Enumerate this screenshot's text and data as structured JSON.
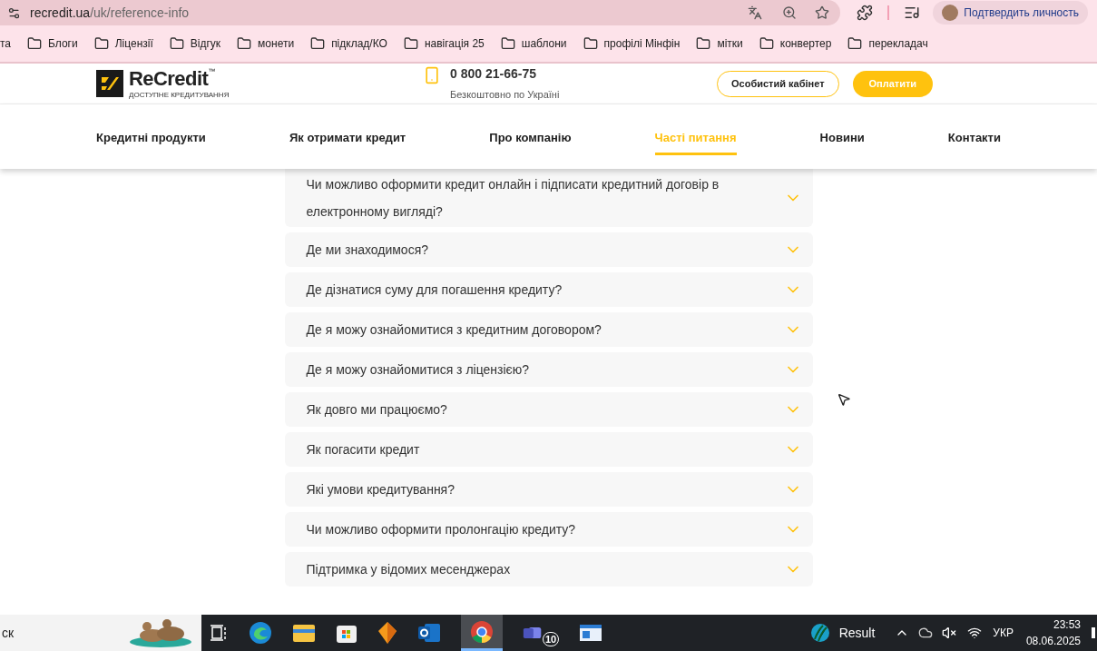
{
  "browser": {
    "url_host": "recredit.ua",
    "url_path": "/uk/reference-info",
    "profile_label": "Подтвердить личность",
    "bookmarks": [
      "та",
      "Блоги",
      "Ліцензії",
      "Відгук",
      "монети",
      "підклад/КО",
      "навігація 25",
      "шаблони",
      "профілі Мінфін",
      "мітки",
      "конвертер",
      "перекладач"
    ]
  },
  "header": {
    "logo_text": "ReCredit",
    "logo_tm": "™",
    "logo_tagline": "ДОСТУПНЕ КРЕДИТУВАННЯ",
    "phone": "0 800 21-66-75",
    "phone_note": "Безкоштовно по Україні",
    "cabinet_button": "Особистий кабінет",
    "pay_button": "Оплатити"
  },
  "nav": [
    {
      "label": "Кредитні продукти",
      "selected": false
    },
    {
      "label": "Як отримати кредит",
      "selected": false
    },
    {
      "label": "Про компанію",
      "selected": false
    },
    {
      "label": "Часті питання",
      "selected": true
    },
    {
      "label": "Новини",
      "selected": false
    },
    {
      "label": "Контакти",
      "selected": false
    }
  ],
  "faq": [
    {
      "question": "Чи можливо оформити кредит онлайн і підписати кредитний договір в електронному вигляді?",
      "expanded": false
    },
    {
      "question": "Де ми знаходимося?",
      "expanded": false
    },
    {
      "question": "Де дізнатися суму для погашення кредиту?",
      "expanded": false
    },
    {
      "question": "Де я можу ознайомитися з кредитним договором?",
      "expanded": false
    },
    {
      "question": "Де я можу ознайомитися з ліцензією?",
      "expanded": false
    },
    {
      "question": "Як довго ми працюємо?",
      "expanded": false
    },
    {
      "question": "Як погасити кредит",
      "expanded": false
    },
    {
      "question": "Які умови кредитування?",
      "expanded": false
    },
    {
      "question": "Чи можливо оформити пролонгацію кредиту?",
      "expanded": false
    },
    {
      "question": "Підтримка у відомих месенджерах",
      "expanded": false
    }
  ],
  "taskbar": {
    "search_text": "ск",
    "teams_badge": "10",
    "weather_label": "Result",
    "language": "УКР",
    "time": "23:53",
    "date": "08.06.2025"
  }
}
